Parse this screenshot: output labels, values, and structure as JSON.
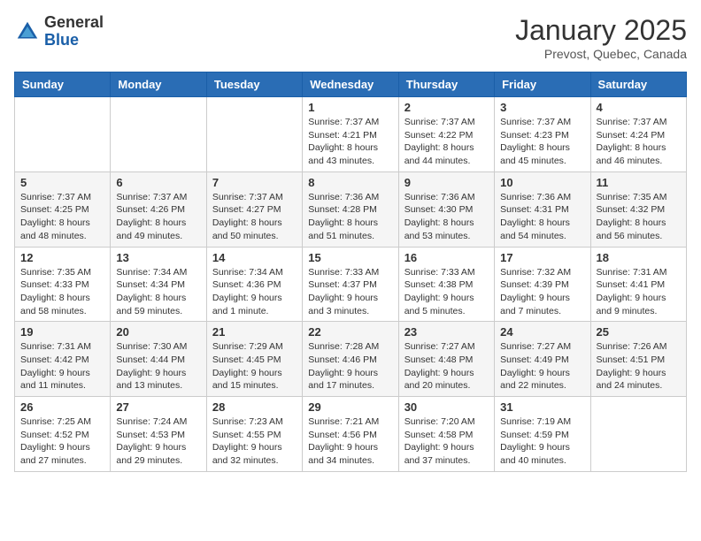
{
  "header": {
    "logo_general": "General",
    "logo_blue": "Blue",
    "month": "January 2025",
    "location": "Prevost, Quebec, Canada"
  },
  "weekdays": [
    "Sunday",
    "Monday",
    "Tuesday",
    "Wednesday",
    "Thursday",
    "Friday",
    "Saturday"
  ],
  "weeks": [
    [
      {
        "num": "",
        "sunrise": "",
        "sunset": "",
        "daylight": ""
      },
      {
        "num": "",
        "sunrise": "",
        "sunset": "",
        "daylight": ""
      },
      {
        "num": "",
        "sunrise": "",
        "sunset": "",
        "daylight": ""
      },
      {
        "num": "1",
        "sunrise": "Sunrise: 7:37 AM",
        "sunset": "Sunset: 4:21 PM",
        "daylight": "Daylight: 8 hours and 43 minutes."
      },
      {
        "num": "2",
        "sunrise": "Sunrise: 7:37 AM",
        "sunset": "Sunset: 4:22 PM",
        "daylight": "Daylight: 8 hours and 44 minutes."
      },
      {
        "num": "3",
        "sunrise": "Sunrise: 7:37 AM",
        "sunset": "Sunset: 4:23 PM",
        "daylight": "Daylight: 8 hours and 45 minutes."
      },
      {
        "num": "4",
        "sunrise": "Sunrise: 7:37 AM",
        "sunset": "Sunset: 4:24 PM",
        "daylight": "Daylight: 8 hours and 46 minutes."
      }
    ],
    [
      {
        "num": "5",
        "sunrise": "Sunrise: 7:37 AM",
        "sunset": "Sunset: 4:25 PM",
        "daylight": "Daylight: 8 hours and 48 minutes."
      },
      {
        "num": "6",
        "sunrise": "Sunrise: 7:37 AM",
        "sunset": "Sunset: 4:26 PM",
        "daylight": "Daylight: 8 hours and 49 minutes."
      },
      {
        "num": "7",
        "sunrise": "Sunrise: 7:37 AM",
        "sunset": "Sunset: 4:27 PM",
        "daylight": "Daylight: 8 hours and 50 minutes."
      },
      {
        "num": "8",
        "sunrise": "Sunrise: 7:36 AM",
        "sunset": "Sunset: 4:28 PM",
        "daylight": "Daylight: 8 hours and 51 minutes."
      },
      {
        "num": "9",
        "sunrise": "Sunrise: 7:36 AM",
        "sunset": "Sunset: 4:30 PM",
        "daylight": "Daylight: 8 hours and 53 minutes."
      },
      {
        "num": "10",
        "sunrise": "Sunrise: 7:36 AM",
        "sunset": "Sunset: 4:31 PM",
        "daylight": "Daylight: 8 hours and 54 minutes."
      },
      {
        "num": "11",
        "sunrise": "Sunrise: 7:35 AM",
        "sunset": "Sunset: 4:32 PM",
        "daylight": "Daylight: 8 hours and 56 minutes."
      }
    ],
    [
      {
        "num": "12",
        "sunrise": "Sunrise: 7:35 AM",
        "sunset": "Sunset: 4:33 PM",
        "daylight": "Daylight: 8 hours and 58 minutes."
      },
      {
        "num": "13",
        "sunrise": "Sunrise: 7:34 AM",
        "sunset": "Sunset: 4:34 PM",
        "daylight": "Daylight: 8 hours and 59 minutes."
      },
      {
        "num": "14",
        "sunrise": "Sunrise: 7:34 AM",
        "sunset": "Sunset: 4:36 PM",
        "daylight": "Daylight: 9 hours and 1 minute."
      },
      {
        "num": "15",
        "sunrise": "Sunrise: 7:33 AM",
        "sunset": "Sunset: 4:37 PM",
        "daylight": "Daylight: 9 hours and 3 minutes."
      },
      {
        "num": "16",
        "sunrise": "Sunrise: 7:33 AM",
        "sunset": "Sunset: 4:38 PM",
        "daylight": "Daylight: 9 hours and 5 minutes."
      },
      {
        "num": "17",
        "sunrise": "Sunrise: 7:32 AM",
        "sunset": "Sunset: 4:39 PM",
        "daylight": "Daylight: 9 hours and 7 minutes."
      },
      {
        "num": "18",
        "sunrise": "Sunrise: 7:31 AM",
        "sunset": "Sunset: 4:41 PM",
        "daylight": "Daylight: 9 hours and 9 minutes."
      }
    ],
    [
      {
        "num": "19",
        "sunrise": "Sunrise: 7:31 AM",
        "sunset": "Sunset: 4:42 PM",
        "daylight": "Daylight: 9 hours and 11 minutes."
      },
      {
        "num": "20",
        "sunrise": "Sunrise: 7:30 AM",
        "sunset": "Sunset: 4:44 PM",
        "daylight": "Daylight: 9 hours and 13 minutes."
      },
      {
        "num": "21",
        "sunrise": "Sunrise: 7:29 AM",
        "sunset": "Sunset: 4:45 PM",
        "daylight": "Daylight: 9 hours and 15 minutes."
      },
      {
        "num": "22",
        "sunrise": "Sunrise: 7:28 AM",
        "sunset": "Sunset: 4:46 PM",
        "daylight": "Daylight: 9 hours and 17 minutes."
      },
      {
        "num": "23",
        "sunrise": "Sunrise: 7:27 AM",
        "sunset": "Sunset: 4:48 PM",
        "daylight": "Daylight: 9 hours and 20 minutes."
      },
      {
        "num": "24",
        "sunrise": "Sunrise: 7:27 AM",
        "sunset": "Sunset: 4:49 PM",
        "daylight": "Daylight: 9 hours and 22 minutes."
      },
      {
        "num": "25",
        "sunrise": "Sunrise: 7:26 AM",
        "sunset": "Sunset: 4:51 PM",
        "daylight": "Daylight: 9 hours and 24 minutes."
      }
    ],
    [
      {
        "num": "26",
        "sunrise": "Sunrise: 7:25 AM",
        "sunset": "Sunset: 4:52 PM",
        "daylight": "Daylight: 9 hours and 27 minutes."
      },
      {
        "num": "27",
        "sunrise": "Sunrise: 7:24 AM",
        "sunset": "Sunset: 4:53 PM",
        "daylight": "Daylight: 9 hours and 29 minutes."
      },
      {
        "num": "28",
        "sunrise": "Sunrise: 7:23 AM",
        "sunset": "Sunset: 4:55 PM",
        "daylight": "Daylight: 9 hours and 32 minutes."
      },
      {
        "num": "29",
        "sunrise": "Sunrise: 7:21 AM",
        "sunset": "Sunset: 4:56 PM",
        "daylight": "Daylight: 9 hours and 34 minutes."
      },
      {
        "num": "30",
        "sunrise": "Sunrise: 7:20 AM",
        "sunset": "Sunset: 4:58 PM",
        "daylight": "Daylight: 9 hours and 37 minutes."
      },
      {
        "num": "31",
        "sunrise": "Sunrise: 7:19 AM",
        "sunset": "Sunset: 4:59 PM",
        "daylight": "Daylight: 9 hours and 40 minutes."
      },
      {
        "num": "",
        "sunrise": "",
        "sunset": "",
        "daylight": ""
      }
    ]
  ]
}
